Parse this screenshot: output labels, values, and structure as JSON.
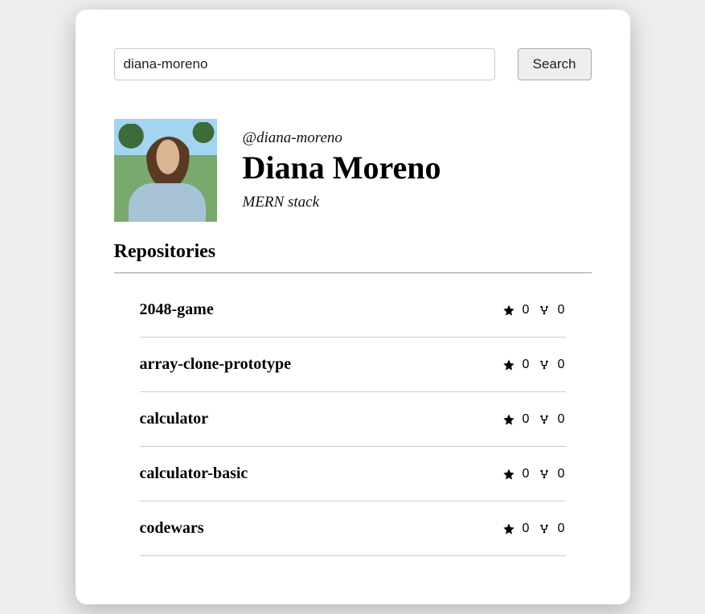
{
  "search": {
    "value": "diana-moreno",
    "button_label": "Search"
  },
  "profile": {
    "handle": "@diana-moreno",
    "name": "Diana Moreno",
    "bio": "MERN stack"
  },
  "section": {
    "title": "Repositories"
  },
  "repos": [
    {
      "name": "2048-game",
      "stars": "0",
      "forks": "0"
    },
    {
      "name": "array-clone-prototype",
      "stars": "0",
      "forks": "0"
    },
    {
      "name": "calculator",
      "stars": "0",
      "forks": "0"
    },
    {
      "name": "calculator-basic",
      "stars": "0",
      "forks": "0"
    },
    {
      "name": "codewars",
      "stars": "0",
      "forks": "0"
    }
  ]
}
